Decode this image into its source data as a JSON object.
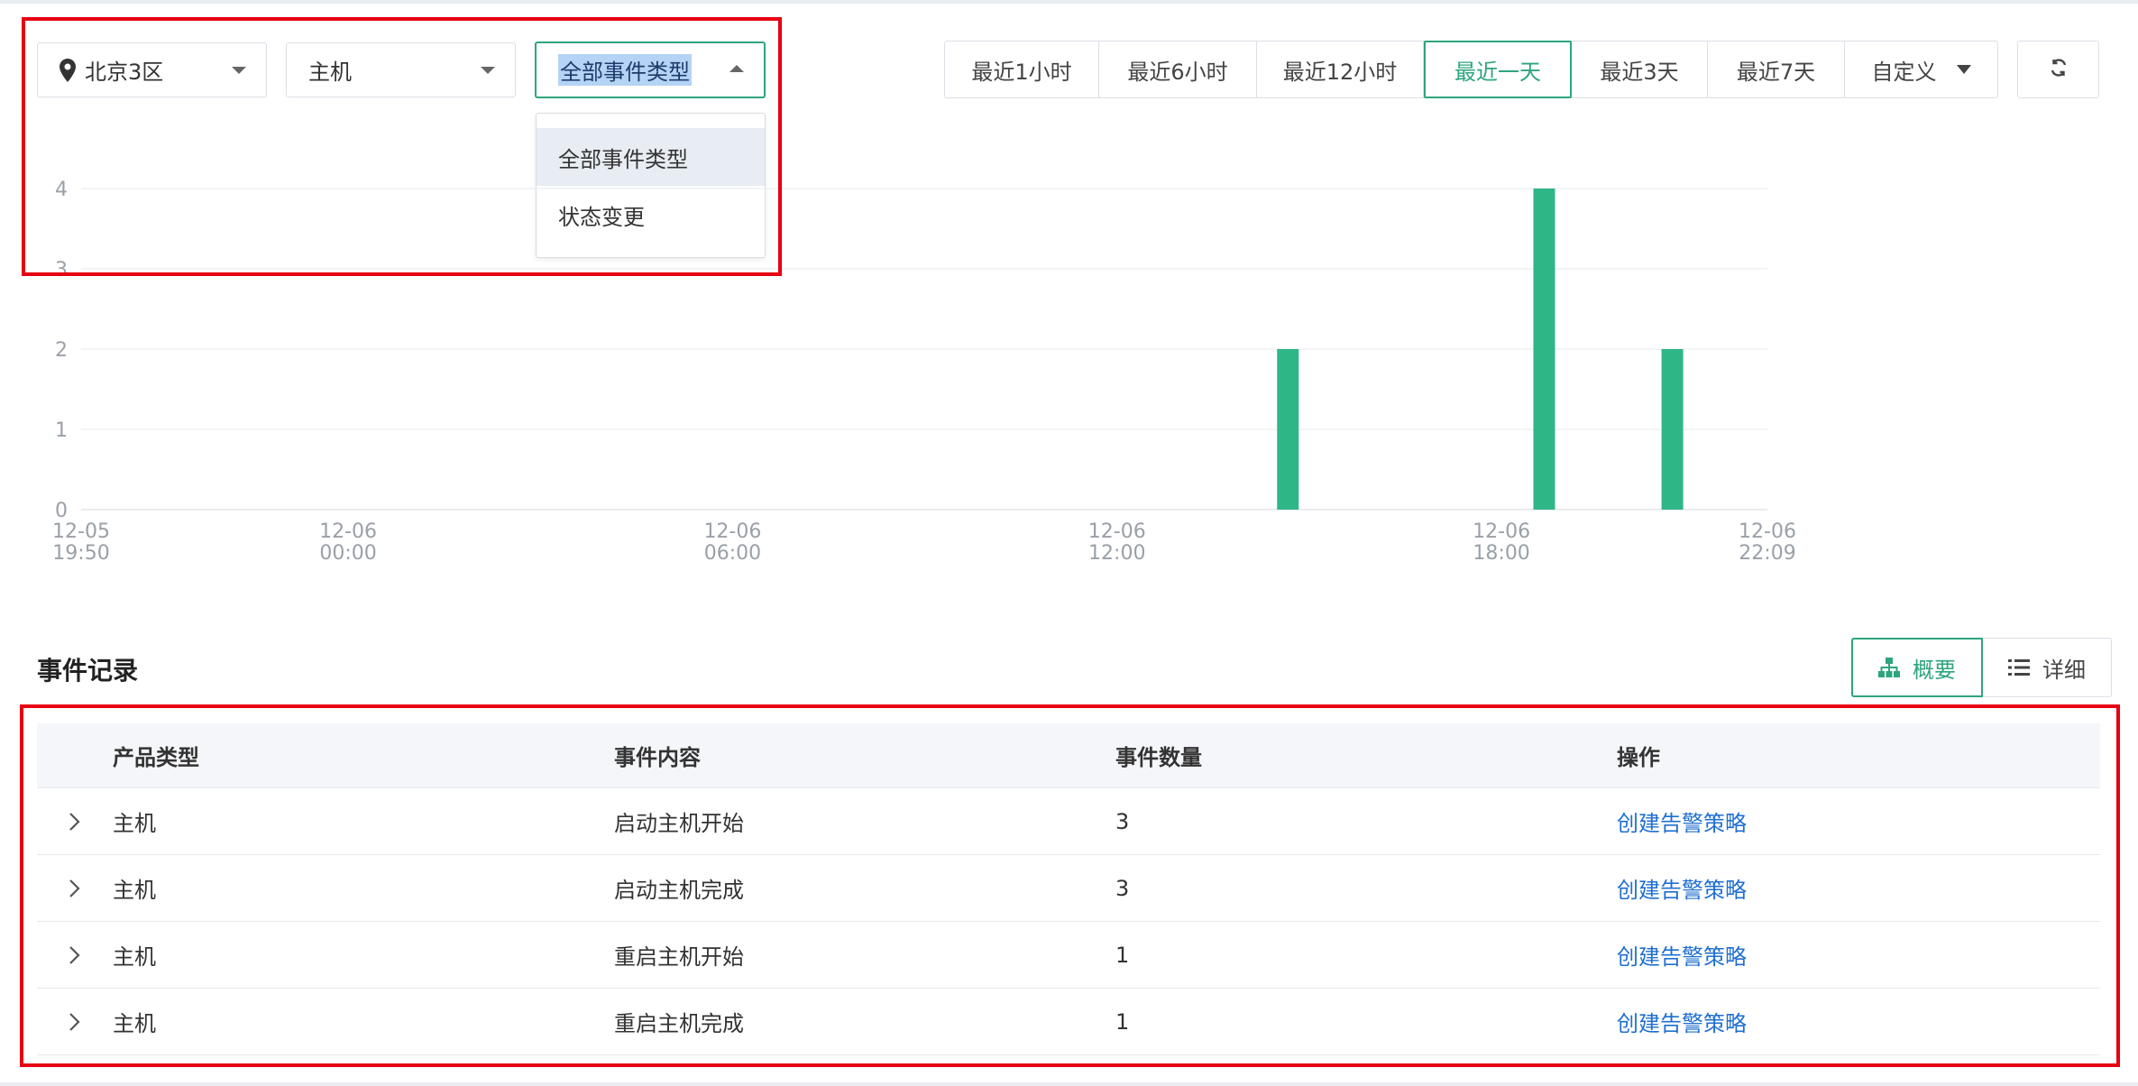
{
  "filters": {
    "region": "北京3区",
    "product": "主机",
    "event_type": "全部事件类型",
    "event_type_options": [
      "全部事件类型",
      "状态变更"
    ]
  },
  "time_ranges": [
    {
      "label": "最近1小时",
      "active": false
    },
    {
      "label": "最近6小时",
      "active": false
    },
    {
      "label": "最近12小时",
      "active": false
    },
    {
      "label": "最近一天",
      "active": true
    },
    {
      "label": "最近3天",
      "active": false
    },
    {
      "label": "最近7天",
      "active": false
    },
    {
      "label": "自定义",
      "active": false,
      "dropdown": true
    }
  ],
  "chart_data": {
    "type": "bar",
    "ylim": [
      0,
      4
    ],
    "y_ticks": [
      "0",
      "1",
      "2",
      "3",
      "4"
    ],
    "x_ticks": [
      {
        "date": "12-05",
        "time": "19:50"
      },
      {
        "date": "12-06",
        "time": "00:00"
      },
      {
        "date": "12-06",
        "time": "06:00"
      },
      {
        "date": "12-06",
        "time": "12:00"
      },
      {
        "date": "12-06",
        "time": "18:00"
      },
      {
        "date": "12-06",
        "time": "22:09"
      }
    ],
    "bars": [
      {
        "time": "12-06 14:40",
        "value": 2
      },
      {
        "time": "12-06 18:40",
        "value": 4
      },
      {
        "time": "12-06 20:40",
        "value": 2
      }
    ],
    "bar_color": "#2fb687"
  },
  "section": {
    "title": "事件记录",
    "views": [
      "概要",
      "详细"
    ]
  },
  "table": {
    "headers": [
      "产品类型",
      "事件内容",
      "事件数量",
      "操作"
    ],
    "rows": [
      {
        "product": "主机",
        "content": "启动主机开始",
        "count": "3",
        "action": "创建告警策略"
      },
      {
        "product": "主机",
        "content": "启动主机完成",
        "count": "3",
        "action": "创建告警策略"
      },
      {
        "product": "主机",
        "content": "重启主机开始",
        "count": "1",
        "action": "创建告警策略"
      },
      {
        "product": "主机",
        "content": "重启主机完成",
        "count": "1",
        "action": "创建告警策略"
      }
    ]
  },
  "colors": {
    "accent": "#2ea57c",
    "link": "#1f6fd1",
    "highlight": "#e60012"
  }
}
